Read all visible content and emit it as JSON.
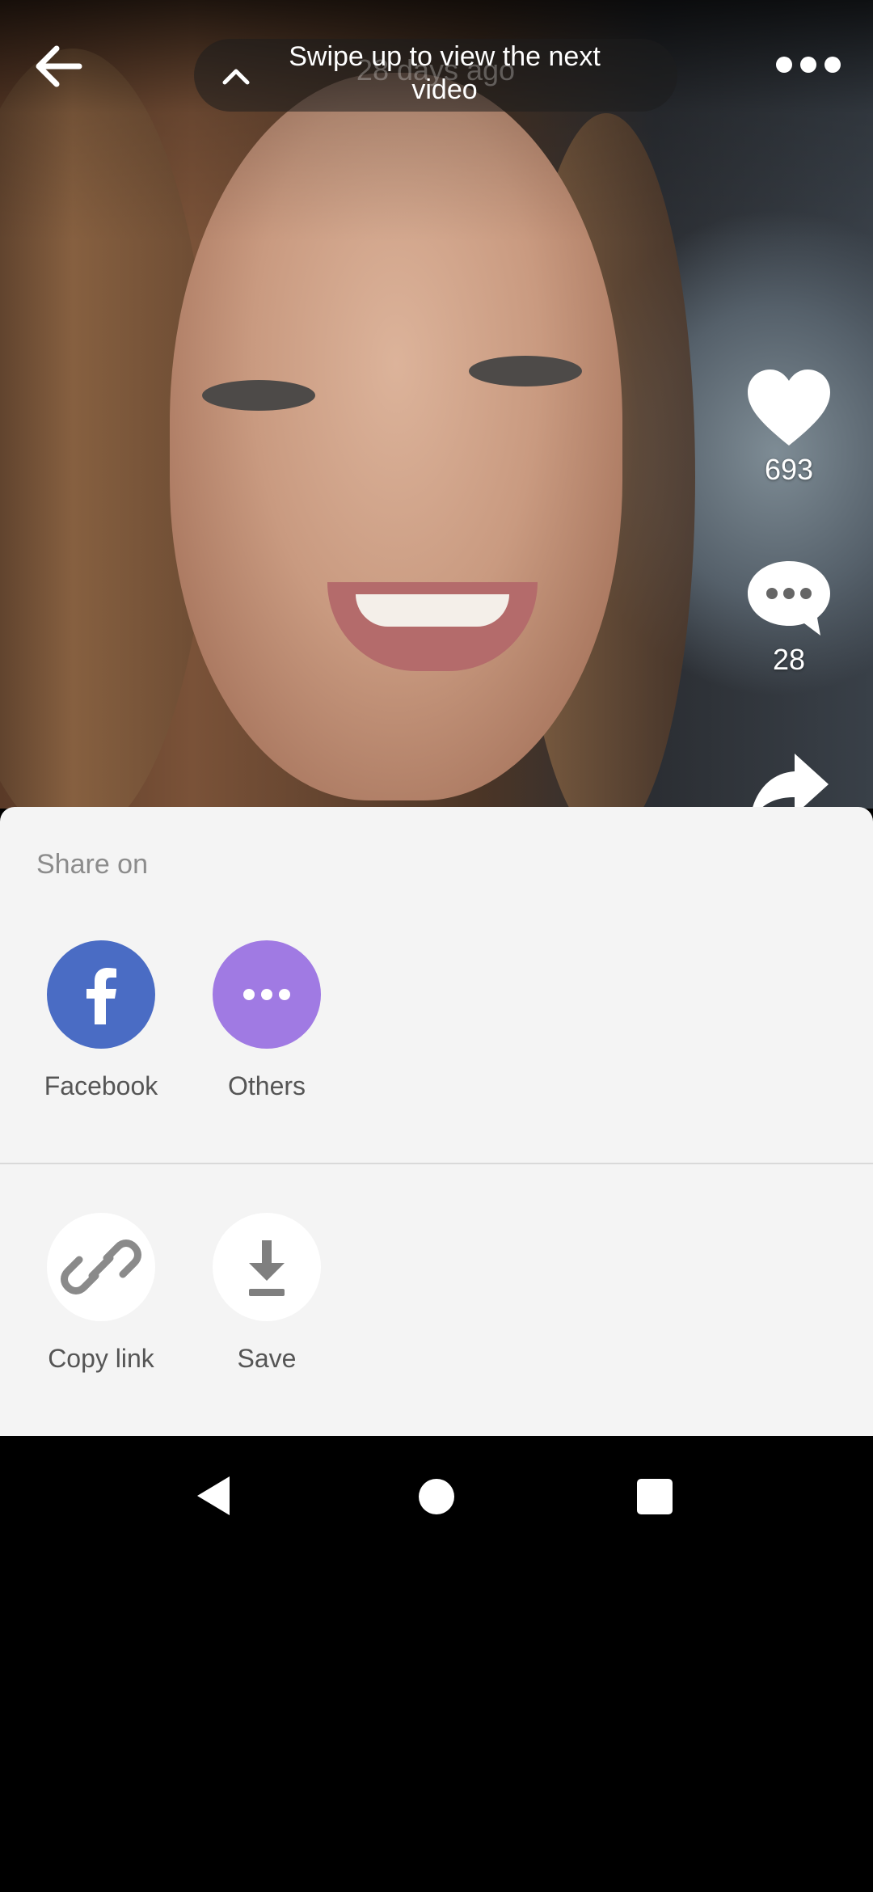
{
  "top_bar": {
    "toast_faint_text": "28 days ago",
    "toast_text": "Swipe up to view the next video"
  },
  "side_actions": {
    "likes_count": "693",
    "comments_count": "28"
  },
  "share_sheet": {
    "title": "Share on",
    "social_options": [
      {
        "label": "Facebook",
        "icon": "facebook-icon",
        "color": "#4a6cc4"
      },
      {
        "label": "Others",
        "icon": "more-horizontal-icon",
        "color": "#a07ae3"
      }
    ],
    "action_options": [
      {
        "label": "Copy link",
        "icon": "link-icon"
      },
      {
        "label": "Save",
        "icon": "download-icon"
      }
    ]
  },
  "nav_bar": {
    "icons": [
      "back-triangle-icon",
      "home-circle-icon",
      "recents-square-icon"
    ]
  }
}
